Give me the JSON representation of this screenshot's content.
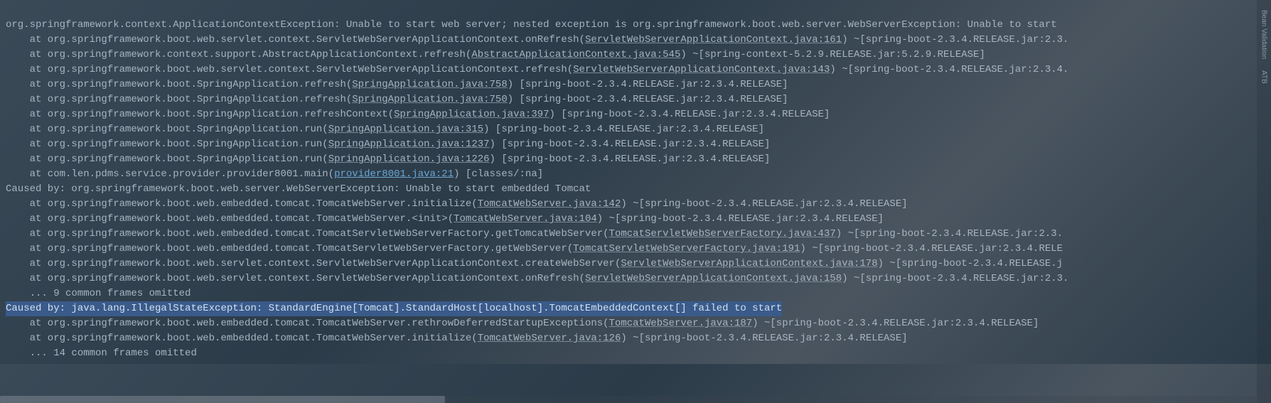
{
  "sidebar": {
    "tabs": [
      "Bean Validation",
      "ATB"
    ]
  },
  "stacktrace": {
    "lines": [
      {
        "type": "exception",
        "text": "org.springframework.context.ApplicationContextException: Unable to start web server; nested exception is org.springframework.boot.web.server.WebServerException: Unable to start"
      },
      {
        "type": "at",
        "prefix": "    at org.springframework.boot.web.servlet.context.ServletWebServerApplicationContext.onRefresh(",
        "link": "ServletWebServerApplicationContext.java:161",
        "suffix": ") ~[spring-boot-2.3.4.RELEASE.jar:2.3."
      },
      {
        "type": "at",
        "prefix": "    at org.springframework.context.support.AbstractApplicationContext.refresh(",
        "link": "AbstractApplicationContext.java:545",
        "suffix": ") ~[spring-context-5.2.9.RELEASE.jar:5.2.9.RELEASE]"
      },
      {
        "type": "at",
        "prefix": "    at org.springframework.boot.web.servlet.context.ServletWebServerApplicationContext.refresh(",
        "link": "ServletWebServerApplicationContext.java:143",
        "suffix": ") ~[spring-boot-2.3.4.RELEASE.jar:2.3.4."
      },
      {
        "type": "at",
        "prefix": "    at org.springframework.boot.SpringApplication.refresh(",
        "link": "SpringApplication.java:758",
        "suffix": ") [spring-boot-2.3.4.RELEASE.jar:2.3.4.RELEASE]"
      },
      {
        "type": "at",
        "prefix": "    at org.springframework.boot.SpringApplication.refresh(",
        "link": "SpringApplication.java:750",
        "suffix": ") [spring-boot-2.3.4.RELEASE.jar:2.3.4.RELEASE]"
      },
      {
        "type": "at",
        "prefix": "    at org.springframework.boot.SpringApplication.refreshContext(",
        "link": "SpringApplication.java:397",
        "suffix": ") [spring-boot-2.3.4.RELEASE.jar:2.3.4.RELEASE]"
      },
      {
        "type": "at",
        "prefix": "    at org.springframework.boot.SpringApplication.run(",
        "link": "SpringApplication.java:315",
        "suffix": ") [spring-boot-2.3.4.RELEASE.jar:2.3.4.RELEASE]"
      },
      {
        "type": "at",
        "prefix": "    at org.springframework.boot.SpringApplication.run(",
        "link": "SpringApplication.java:1237",
        "suffix": ") [spring-boot-2.3.4.RELEASE.jar:2.3.4.RELEASE]"
      },
      {
        "type": "at",
        "prefix": "    at org.springframework.boot.SpringApplication.run(",
        "link": "SpringApplication.java:1226",
        "suffix": ") [spring-boot-2.3.4.RELEASE.jar:2.3.4.RELEASE]"
      },
      {
        "type": "at_highlighted",
        "prefix": "    at com.len.pdms.service.provider.provider8001.main(",
        "link": "provider8001.java:21",
        "suffix": ") [classes/:na]"
      },
      {
        "type": "caused",
        "text": "Caused by: org.springframework.boot.web.server.WebServerException: Unable to start embedded Tomcat"
      },
      {
        "type": "at",
        "prefix": "    at org.springframework.boot.web.embedded.tomcat.TomcatWebServer.initialize(",
        "link": "TomcatWebServer.java:142",
        "suffix": ") ~[spring-boot-2.3.4.RELEASE.jar:2.3.4.RELEASE]"
      },
      {
        "type": "at",
        "prefix": "    at org.springframework.boot.web.embedded.tomcat.TomcatWebServer.<init>(",
        "link": "TomcatWebServer.java:104",
        "suffix": ") ~[spring-boot-2.3.4.RELEASE.jar:2.3.4.RELEASE]"
      },
      {
        "type": "at",
        "prefix": "    at org.springframework.boot.web.embedded.tomcat.TomcatServletWebServerFactory.getTomcatWebServer(",
        "link": "TomcatServletWebServerFactory.java:437",
        "suffix": ") ~[spring-boot-2.3.4.RELEASE.jar:2.3."
      },
      {
        "type": "at",
        "prefix": "    at org.springframework.boot.web.embedded.tomcat.TomcatServletWebServerFactory.getWebServer(",
        "link": "TomcatServletWebServerFactory.java:191",
        "suffix": ") ~[spring-boot-2.3.4.RELEASE.jar:2.3.4.RELE"
      },
      {
        "type": "at",
        "prefix": "    at org.springframework.boot.web.servlet.context.ServletWebServerApplicationContext.createWebServer(",
        "link": "ServletWebServerApplicationContext.java:178",
        "suffix": ") ~[spring-boot-2.3.4.RELEASE.j"
      },
      {
        "type": "at",
        "prefix": "    at org.springframework.boot.web.servlet.context.ServletWebServerApplicationContext.onRefresh(",
        "link": "ServletWebServerApplicationContext.java:158",
        "suffix": ") ~[spring-boot-2.3.4.RELEASE.jar:2.3."
      },
      {
        "type": "omitted",
        "text": "    ... 9 common frames omitted"
      },
      {
        "type": "selected",
        "text": "Caused by: java.lang.IllegalStateException: StandardEngine[Tomcat].StandardHost[localhost].TomcatEmbeddedContext[] failed to start"
      },
      {
        "type": "at",
        "prefix": "    at org.springframework.boot.web.embedded.tomcat.TomcatWebServer.rethrowDeferredStartupExceptions(",
        "link": "TomcatWebServer.java:187",
        "suffix": ") ~[spring-boot-2.3.4.RELEASE.jar:2.3.4.RELEASE]"
      },
      {
        "type": "at",
        "prefix": "    at org.springframework.boot.web.embedded.tomcat.TomcatWebServer.initialize(",
        "link": "TomcatWebServer.java:126",
        "suffix": ") ~[spring-boot-2.3.4.RELEASE.jar:2.3.4.RELEASE]"
      },
      {
        "type": "omitted",
        "text": "    ... 14 common frames omitted"
      }
    ]
  }
}
